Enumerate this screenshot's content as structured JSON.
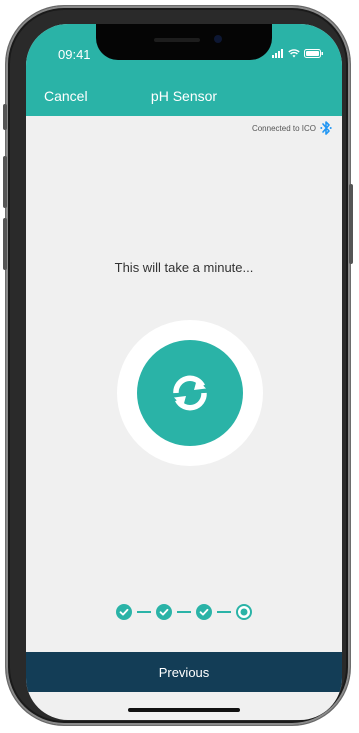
{
  "status_bar": {
    "time": "09:41",
    "icons": [
      "signal-icon",
      "wifi-icon",
      "battery-icon"
    ]
  },
  "nav": {
    "cancel_label": "Cancel",
    "title": "pH Sensor"
  },
  "connection": {
    "text": "Connected to ICO",
    "icon": "bluetooth-icon"
  },
  "main": {
    "message": "This will take a minute...",
    "spinner_icon": "sync-icon"
  },
  "steps": {
    "total": 4,
    "completed": 3,
    "current": 4
  },
  "footer": {
    "previous_label": "Previous"
  },
  "colors": {
    "accent": "#2ab3a7",
    "footer": "#133d56",
    "background": "#f0f0f0",
    "bluetooth": "#2196f3"
  }
}
